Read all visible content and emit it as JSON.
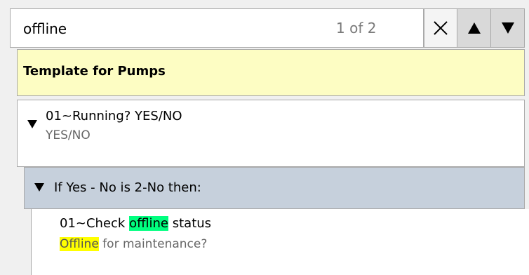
{
  "search": {
    "value": "offline",
    "match_count": "1 of 2"
  },
  "icons": {
    "clear": "close-icon",
    "previous": "up-triangle-icon",
    "next": "down-triangle-icon",
    "expand": "expanded-triangle-icon"
  },
  "template": {
    "title": "Template for Pumps"
  },
  "question": {
    "title": "01~Running? YES/NO",
    "answer_type": "YES/NO"
  },
  "condition": {
    "label": "If Yes - No is 2-No then:"
  },
  "sub_question": {
    "title_prefix": "01~Check ",
    "title_highlight": "offline",
    "title_suffix": " status",
    "answer_highlight": "Offline",
    "answer_suffix": " for maintenance?"
  },
  "colors": {
    "template_header_bg": "#fdfdc3",
    "condition_bg": "#c6d0dc",
    "current_match_highlight": "#00ff7f",
    "other_match_highlight": "#ffff00"
  }
}
